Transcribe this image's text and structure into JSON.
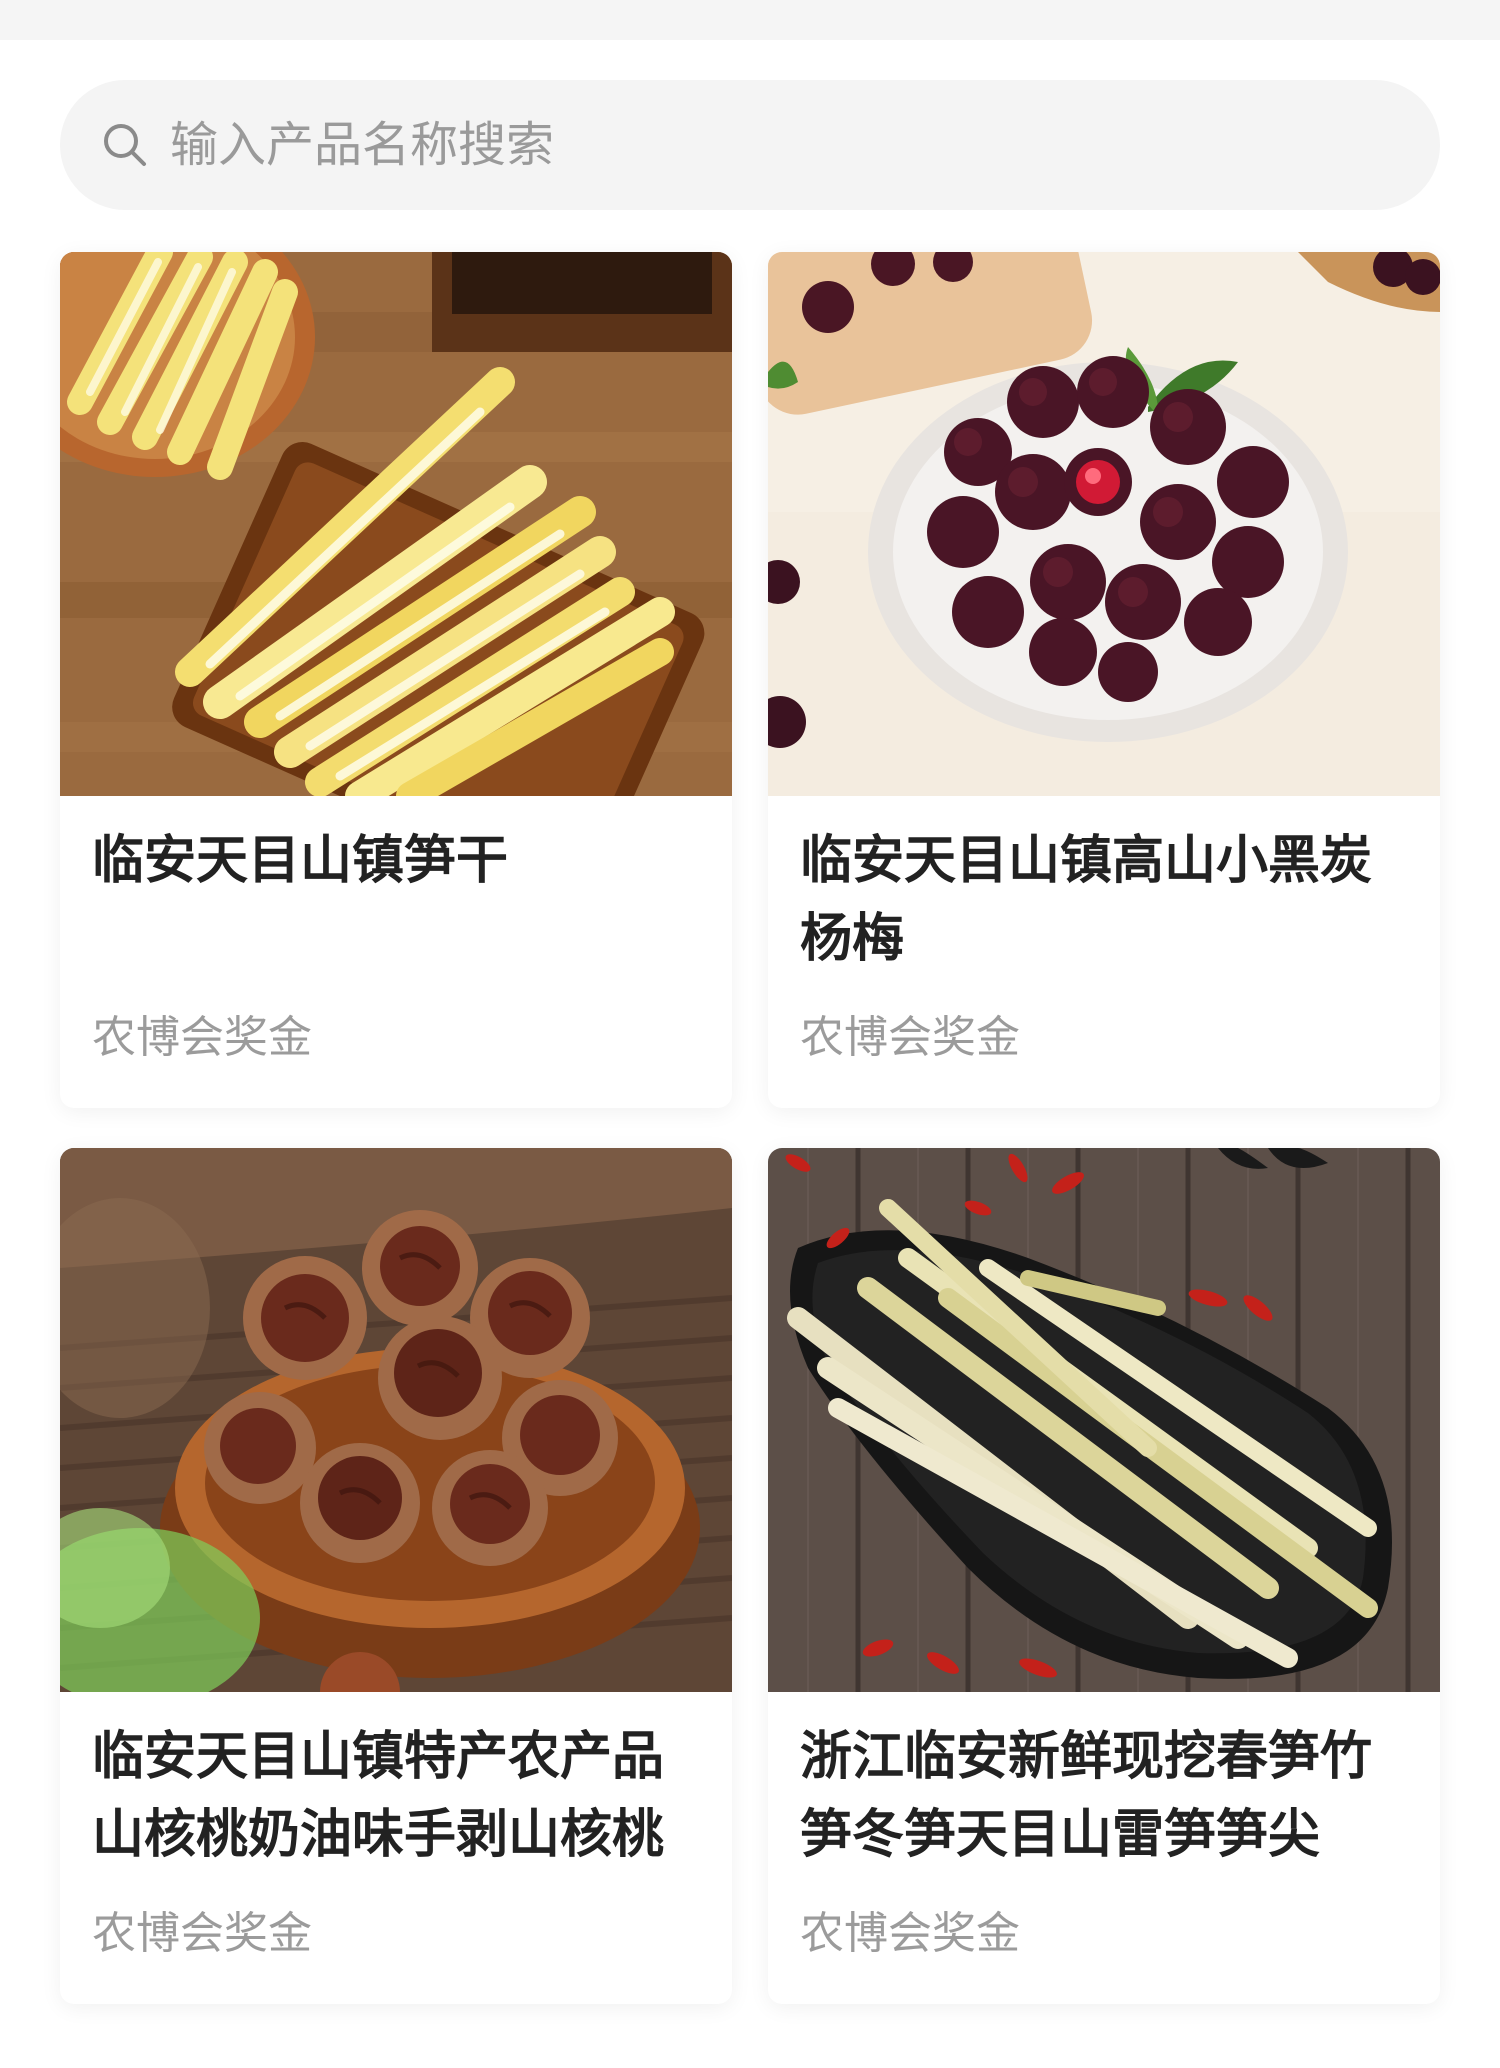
{
  "search": {
    "placeholder": "输入产品名称搜索"
  },
  "products": [
    {
      "title": "临安天目山镇笋干",
      "award": "农博会奖金",
      "image": "dried-bamboo-shoots-photo"
    },
    {
      "title": "临安天目山镇高山小黑炭杨梅",
      "award": "农博会奖金",
      "image": "bayberry-photo"
    },
    {
      "title": "临安天目山镇特产农产品山核桃奶油味手剥山核桃",
      "award": "农博会奖金",
      "image": "hickory-nuts-photo"
    },
    {
      "title": "浙江临安新鲜现挖春笋竹笋冬笋天目山雷笋笋尖",
      "award": "农博会奖金",
      "image": "fresh-bamboo-shoots-photo"
    }
  ]
}
